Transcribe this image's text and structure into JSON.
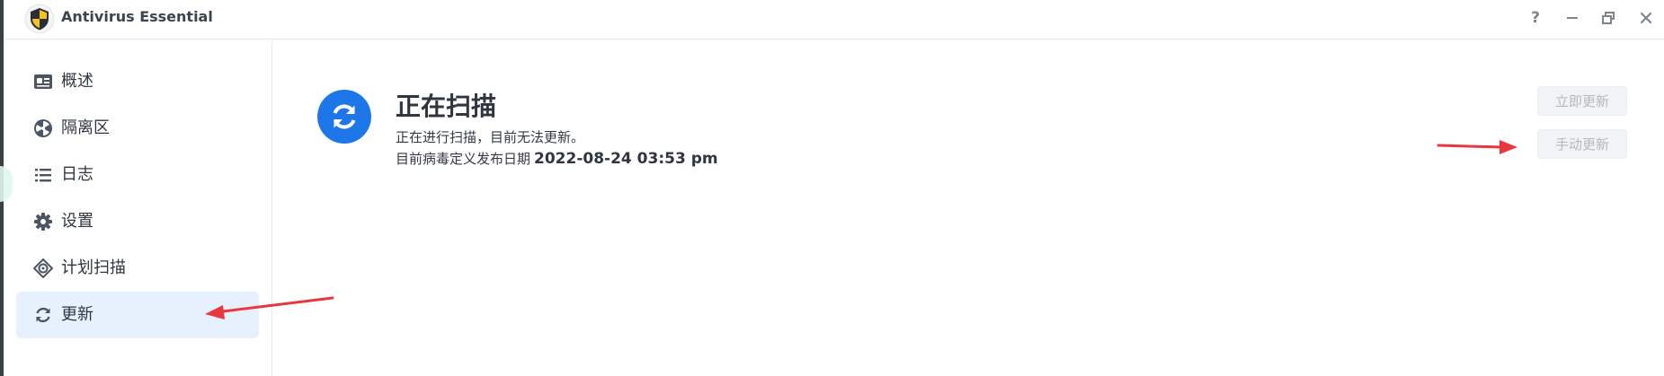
{
  "app": {
    "title": "Antivirus Essential"
  },
  "window_controls": {
    "help_label": "?",
    "icons": [
      "question-icon",
      "minimize-icon",
      "restore-icon",
      "close-icon"
    ]
  },
  "sidebar": {
    "items": [
      {
        "label": "概述",
        "icon": "overview-card-icon",
        "active": false
      },
      {
        "label": "隔离区",
        "icon": "radiation-icon",
        "active": false
      },
      {
        "label": "日志",
        "icon": "list-icon",
        "active": false
      },
      {
        "label": "设置",
        "icon": "gear-icon",
        "active": false
      },
      {
        "label": "计划扫描",
        "icon": "target-icon",
        "active": false
      },
      {
        "label": "更新",
        "icon": "refresh-icon",
        "active": true
      }
    ]
  },
  "main": {
    "status_title": "正在扫描",
    "status_desc": "正在进行扫描，目前无法更新。",
    "defs_label": "目前病毒定义发布日期",
    "defs_date": "2022-08-24 03:53 pm",
    "buttons": {
      "update_now": "立即更新",
      "manual_update": "手动更新"
    }
  },
  "colors": {
    "accent": "#1e77e9",
    "active_bg": "#e6f1fd",
    "annotation_arrow": "#e8383d",
    "disabled_button_text": "#b4b9bf"
  }
}
